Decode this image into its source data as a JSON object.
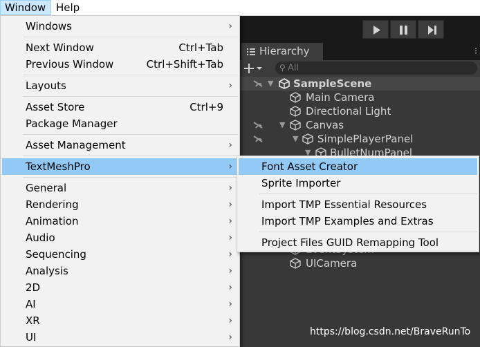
{
  "menubar": {
    "items": [
      "Window",
      "Help"
    ]
  },
  "window_menu": {
    "items": [
      {
        "label": "Windows",
        "shortcut": "",
        "submenu": true
      },
      {
        "label": "Next Window",
        "shortcut": "Ctrl+Tab",
        "submenu": false
      },
      {
        "label": "Previous Window",
        "shortcut": "Ctrl+Shift+Tab",
        "submenu": false
      },
      {
        "label": "Layouts",
        "shortcut": "",
        "submenu": true
      },
      {
        "label": "Asset Store",
        "shortcut": "Ctrl+9",
        "submenu": false
      },
      {
        "label": "Package Manager",
        "shortcut": "",
        "submenu": false
      },
      {
        "label": "Asset Management",
        "shortcut": "",
        "submenu": true
      },
      {
        "label": "TextMeshPro",
        "shortcut": "",
        "submenu": true
      },
      {
        "label": "General",
        "shortcut": "",
        "submenu": true
      },
      {
        "label": "Rendering",
        "shortcut": "",
        "submenu": true
      },
      {
        "label": "Animation",
        "shortcut": "",
        "submenu": true
      },
      {
        "label": "Audio",
        "shortcut": "",
        "submenu": true
      },
      {
        "label": "Sequencing",
        "shortcut": "",
        "submenu": true
      },
      {
        "label": "Analysis",
        "shortcut": "",
        "submenu": true
      },
      {
        "label": "2D",
        "shortcut": "",
        "submenu": true
      },
      {
        "label": "AI",
        "shortcut": "",
        "submenu": true
      },
      {
        "label": "XR",
        "shortcut": "",
        "submenu": true
      },
      {
        "label": "UI",
        "shortcut": "",
        "submenu": true
      }
    ],
    "highlighted": "TextMeshPro"
  },
  "textmeshpro_submenu": {
    "items": [
      "Font Asset Creator",
      "Sprite Importer",
      "Import TMP Essential Resources",
      "Import TMP Examples and Extras",
      "Project Files GUID Remapping Tool"
    ],
    "highlighted": "Font Asset Creator"
  },
  "hierarchy": {
    "tab_label": "Hierarchy",
    "search_placeholder": "All",
    "scene_name": "SampleScene",
    "rows": [
      "Main Camera",
      "Directional Light",
      "Canvas",
      "SimplePlayerPanel",
      "BulletNumPanel",
      "EventSystem",
      "UICamera"
    ]
  },
  "watermark": "https://blog.csdn.net/BraveRunTo",
  "colors": {
    "menu_highlight": "#91c9f7",
    "menubar_active": "#cce8ff",
    "editor_bg": "#383838"
  },
  "icons": [
    "play-icon",
    "pause-icon",
    "step-icon",
    "hierarchy-list-icon",
    "add-plus-icon",
    "search-icon",
    "unity-scene-icon",
    "gameobject-cube-icon",
    "submenu-arrow-icon",
    "visibility-hidden-icon"
  ]
}
